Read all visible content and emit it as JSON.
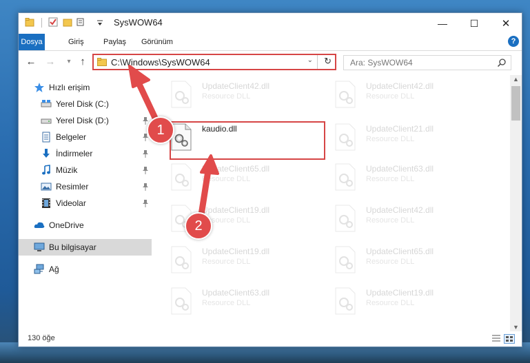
{
  "window": {
    "title": "SysWOW64",
    "controls": {
      "minimize": "—",
      "maximize": "☐",
      "close": "✕"
    }
  },
  "ribbon": {
    "tabs": [
      "Dosya",
      "Giriş",
      "Paylaş",
      "Görünüm"
    ],
    "help": "?"
  },
  "address": {
    "path": "C:\\Windows\\SysWOW64",
    "search_placeholder": "Ara: SysWOW64"
  },
  "sidebar": {
    "quick_access": "Hızlı erişim",
    "items": [
      {
        "label": "Yerel Disk (C:)",
        "pinned": false
      },
      {
        "label": "Yerel Disk (D:)",
        "pinned": true
      },
      {
        "label": "Belgeler",
        "pinned": true
      },
      {
        "label": "İndirmeler",
        "pinned": true
      },
      {
        "label": "Müzik",
        "pinned": true
      },
      {
        "label": "Resimler",
        "pinned": true
      },
      {
        "label": "Videolar",
        "pinned": true
      }
    ],
    "onedrive": "OneDrive",
    "this_pc": "Bu bilgisayar",
    "network": "Ağ"
  },
  "files": {
    "highlighted": {
      "name": "kaudio.dll",
      "type": ""
    },
    "background": [
      {
        "name": "UpdateClient42.dll",
        "type": "Resource DLL"
      },
      {
        "name": "UpdateClient42.dll",
        "type": "Resource DLL"
      },
      {
        "name": "UpdateClient21.dll",
        "type": "Resource DLL"
      },
      {
        "name": "UpdateClient65.dll",
        "type": "Resource DLL"
      },
      {
        "name": "UpdateClient63.dll",
        "type": "Resource DLL"
      },
      {
        "name": "UpdateClient19.dll",
        "type": "Resource DLL"
      },
      {
        "name": "UpdateClient42.dll",
        "type": "Resource DLL"
      },
      {
        "name": "UpdateClient19.dll",
        "type": "Resource DLL"
      },
      {
        "name": "UpdateClient65.dll",
        "type": "Resource DLL"
      },
      {
        "name": "UpdateClient63.dll",
        "type": "Resource DLL"
      },
      {
        "name": "UpdateClient19.dll",
        "type": "Resource DLL"
      }
    ]
  },
  "status": {
    "count": "130 öğe"
  },
  "callouts": [
    "1",
    "2"
  ],
  "colors": {
    "accent": "#1a6fc1",
    "highlight": "#d64545",
    "callout": "#e14b4b"
  }
}
